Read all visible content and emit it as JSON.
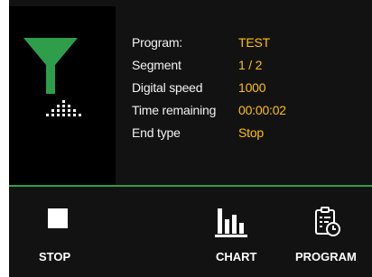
{
  "status": {
    "rows": [
      {
        "label": "Program:",
        "value": "TEST"
      },
      {
        "label": "Segment",
        "value": "1 / 2"
      },
      {
        "label": "Digital speed",
        "value": "1000"
      },
      {
        "label": "Time remaining",
        "value": "00:00:02"
      },
      {
        "label": "End type",
        "value": "Stop"
      }
    ]
  },
  "buttons": {
    "stop": "STOP",
    "chart": "CHART",
    "program": "PROGRAM"
  },
  "icons": {
    "funnel": "funnel-icon",
    "particles": "particles-icon",
    "stop": "stop-icon",
    "chart": "bar-chart-icon",
    "program": "program-schedule-icon"
  },
  "colors": {
    "accent": "#2e9e4a",
    "value_text": "#ffc107",
    "background": "#121212"
  }
}
